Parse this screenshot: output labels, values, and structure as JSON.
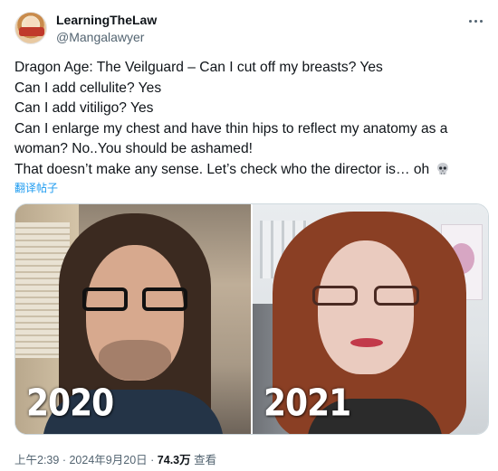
{
  "author": {
    "display_name": "LearningTheLaw",
    "handle": "@Mangalawyer"
  },
  "tweet": {
    "lines": [
      "Dragon Age: The Veilguard – Can I cut off my breasts? Yes",
      "Can I add cellulite? Yes",
      "Can I add vitiligo? Yes",
      "Can I enlarge my chest and have thin hips to reflect my anatomy as a woman? No..You should be ashamed!",
      "That doesn’t make any sense. Let’s check who the director is… oh"
    ],
    "emoji_icon": "skull-icon",
    "translate_label": "翻译帖子"
  },
  "media": {
    "photos": [
      {
        "caption": "2020"
      },
      {
        "caption": "2021"
      }
    ]
  },
  "meta": {
    "time": "上午2:39",
    "separator": "·",
    "date": "2024年9月20日",
    "views_count": "74.3万",
    "views_label": "查看"
  },
  "colors": {
    "link": "#1d9bf0",
    "secondary_text": "#536471",
    "primary_text": "#0f1419"
  }
}
